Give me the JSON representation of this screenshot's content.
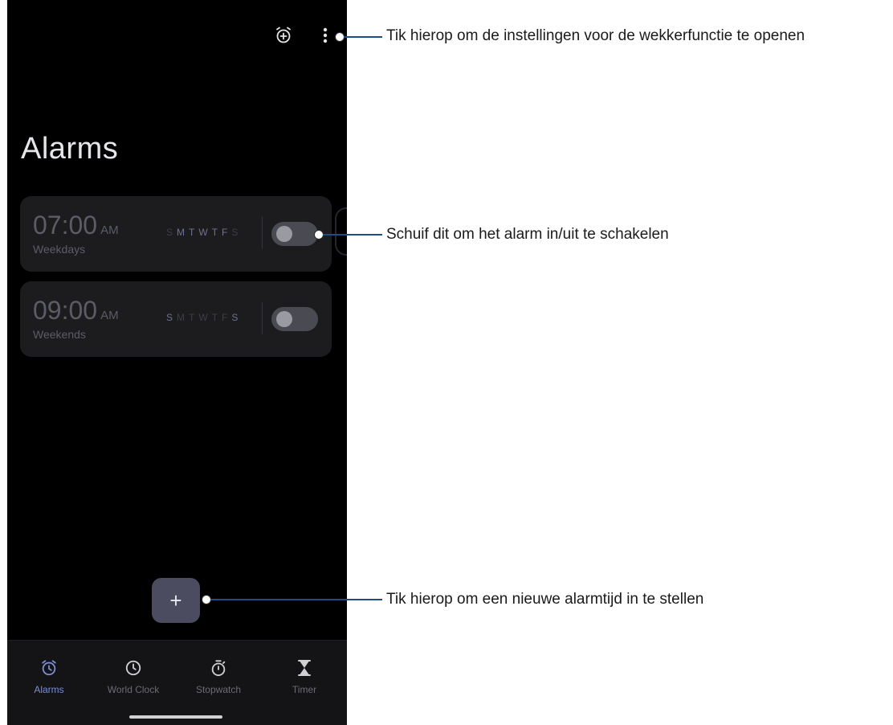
{
  "screen": {
    "title": "Alarms",
    "alarms": [
      {
        "time": "07:00",
        "ampm": "AM",
        "label": "Weekdays",
        "days": [
          "S",
          "M",
          "T",
          "W",
          "T",
          "F",
          "S"
        ],
        "active_days": [
          false,
          true,
          true,
          true,
          true,
          true,
          false
        ],
        "enabled": false
      },
      {
        "time": "09:00",
        "ampm": "AM",
        "label": "Weekends",
        "days": [
          "S",
          "M",
          "T",
          "W",
          "T",
          "F",
          "S"
        ],
        "active_days": [
          true,
          false,
          false,
          false,
          false,
          false,
          true
        ],
        "enabled": false
      }
    ],
    "fab_label": "+",
    "nav": [
      {
        "label": "Alarms",
        "icon": "alarm-clock-icon",
        "active": true
      },
      {
        "label": "World Clock",
        "icon": "clock-icon",
        "active": false
      },
      {
        "label": "Stopwatch",
        "icon": "stopwatch-icon",
        "active": false
      },
      {
        "label": "Timer",
        "icon": "hourglass-icon",
        "active": false
      }
    ],
    "top_icons": [
      "add-alarm-icon",
      "more-vertical-icon"
    ]
  },
  "annotations": {
    "settings": "Tik hierop om de instellingen voor de wekkerfunctie te openen",
    "toggle": "Schuif dit om het alarm in/uit te schakelen",
    "add": "Tik hierop om een nieuwe alarmtijd in te stellen"
  },
  "colors": {
    "background": "#000000",
    "card": "#1c1c1f",
    "accent": "#7b8fd1",
    "fab": "#4b4c60",
    "callout_line": "#1d4e8a"
  }
}
